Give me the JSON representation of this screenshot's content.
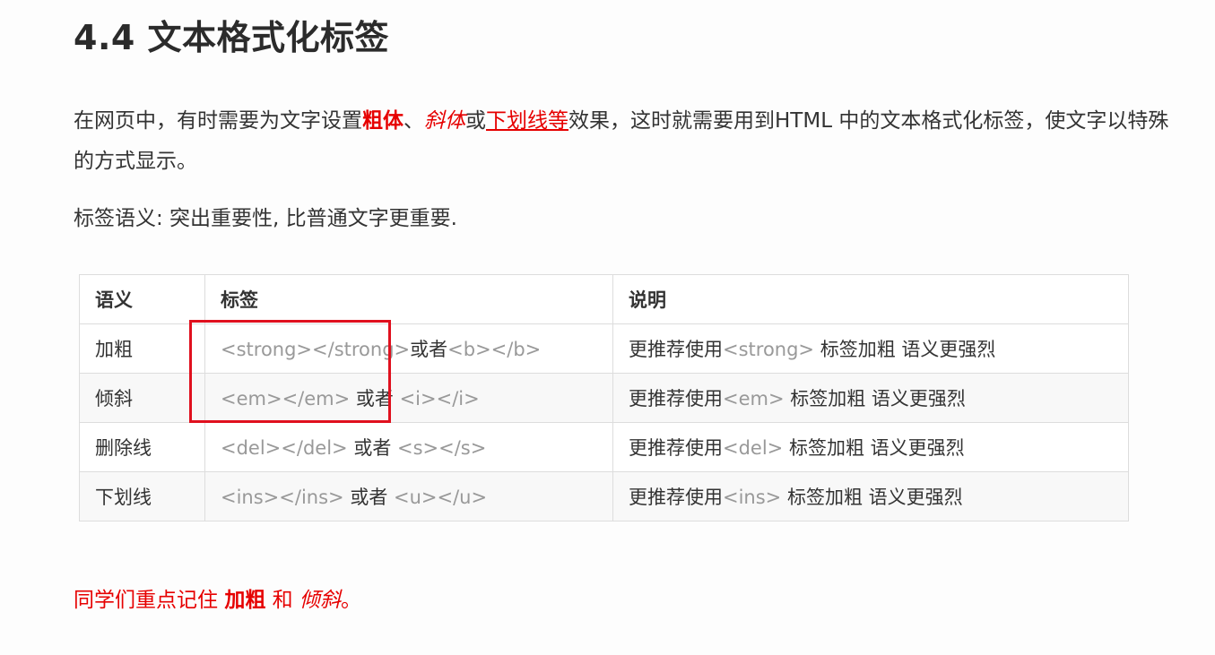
{
  "heading": "4.4 文本格式化标签",
  "intro": {
    "part1": "在网页中，有时需要为文字设置",
    "bold_word": "粗体",
    "sep1": "、",
    "italic_word": "斜体",
    "sep2": "或",
    "underline_word": "下划线等",
    "part2": "效果，这时就需要用到HTML 中的文本格式化标签，使文字以特殊的方式显示。"
  },
  "semantic_note": "标签语义: 突出重要性, 比普通文字更重要.",
  "table": {
    "headers": [
      "语义",
      "标签",
      "说明"
    ],
    "rows": [
      {
        "meaning": "加粗",
        "tag1": "<strong></strong>",
        "or": "或者",
        "tag2": "<b></b>",
        "desc_pre": "更推荐使用",
        "desc_tag": "<strong>",
        "desc_post": " 标签加粗 语义更强烈"
      },
      {
        "meaning": "倾斜",
        "tag1": "<em></em>",
        "or": " 或者 ",
        "tag2": "<i></i>",
        "desc_pre": "更推荐使用",
        "desc_tag": "<em>",
        "desc_post": " 标签加粗 语义更强烈"
      },
      {
        "meaning": "删除线",
        "tag1": "<del></del>",
        "or": " 或者 ",
        "tag2": "<s></s>",
        "desc_pre": "更推荐使用",
        "desc_tag": "<del>",
        "desc_post": " 标签加粗 语义更强烈"
      },
      {
        "meaning": "下划线",
        "tag1": "<ins></ins>",
        "or": " 或者 ",
        "tag2": "<u></u>",
        "desc_pre": "更推荐使用",
        "desc_tag": "<ins>",
        "desc_post": " 标签加粗 语义更强烈"
      }
    ]
  },
  "footer": {
    "pre": "同学们重点记住 ",
    "bold_word": "加粗",
    "mid": " 和 ",
    "italic_word": "倾斜",
    "end": "。"
  },
  "colors": {
    "accent_red": "#e60000",
    "highlight_box": "#e0101e",
    "tag_gray": "#999999"
  }
}
